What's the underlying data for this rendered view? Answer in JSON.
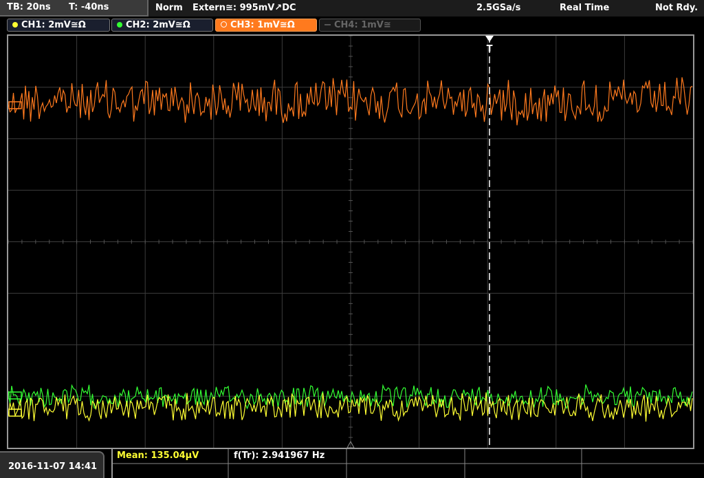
{
  "status_bar": {
    "timebase": "TB: 20ns",
    "trigger_time": "T: -40ns",
    "mode": "Norm",
    "trigger_source": "Extern≅: 995mV↗DC",
    "sample_rate": "2.5GSa/s",
    "acq_mode": "Real Time",
    "state": "Not Rdy."
  },
  "channels": [
    {
      "label": "CH1: 2mV≅Ω",
      "color": "#ffff33",
      "state": "on"
    },
    {
      "label": "CH2: 2mV≅Ω",
      "color": "#33ff33",
      "state": "on"
    },
    {
      "label": "CH3: 1mV≅Ω",
      "color": "#ff7a1e",
      "state": "active"
    },
    {
      "label": "CH4: 1mV≅",
      "color": "#777777",
      "state": "off"
    }
  ],
  "measurements": {
    "mean": "Mean: 135.04µV",
    "freq": "f(Tr): 2.941967 Hz"
  },
  "datetime": "2016-11-07 14:41",
  "colors": {
    "ch1": "#ffff33",
    "ch2": "#33ff33",
    "ch3": "#ff7a1e",
    "grid": "#3d3d3d",
    "background": "#000000"
  },
  "trigger_marker": "T"
}
